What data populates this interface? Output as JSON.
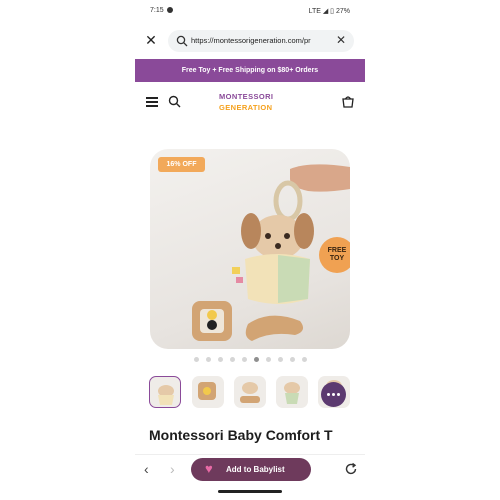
{
  "status_bar": {
    "time": "7:15",
    "right": "LTE ◢ ▯ 27%"
  },
  "browser": {
    "url": "https://montessorigeneration.com/pr",
    "close_icon": "close-icon",
    "clear_icon": "clear-icon"
  },
  "promo": {
    "text": "Free Toy + Free Shipping on $80+ Orders",
    "bg": "#8a4a99"
  },
  "header": {
    "logo_line1": "MONTESSORI",
    "logo_line2": "GENERATION",
    "icons": [
      "menu-icon",
      "search-icon",
      "cart-icon"
    ]
  },
  "product": {
    "discount_badge": "16% OFF",
    "free_badge_line1": "FREE",
    "free_badge_line2": "TOY",
    "title": "Montessori Baby Comfort T",
    "carousel": {
      "total": 10,
      "active_index": 5
    },
    "thumbnails": 5
  },
  "toolbar": {
    "add_label": "Add to Babylist",
    "accent": "#6e3a5c"
  }
}
